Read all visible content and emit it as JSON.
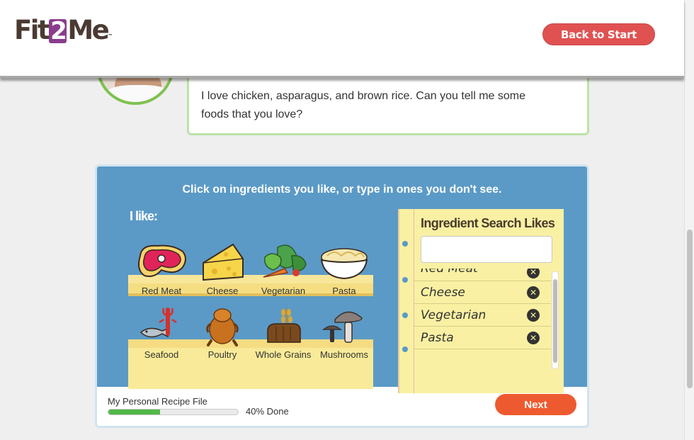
{
  "header": {
    "logo_pre": "Fit",
    "logo_num": "2",
    "logo_post": "Me",
    "logo_tm": "™",
    "back_label": "Back to Start"
  },
  "chat": {
    "line1": "I love chicken, asparagus, and brown rice. Can you tell me some",
    "line2": "foods that you love?"
  },
  "activity": {
    "instruction": "Click on ingredients you like, or type in ones you don't see.",
    "ilike": "I like:",
    "row1": [
      {
        "label": "Red Meat",
        "icon": "red-meat-icon"
      },
      {
        "label": "Cheese",
        "icon": "cheese-icon"
      },
      {
        "label": "Vegetarian",
        "icon": "vegetarian-icon"
      },
      {
        "label": "Pasta",
        "icon": "pasta-icon"
      }
    ],
    "row2": [
      {
        "label": "Seafood",
        "icon": "seafood-icon"
      },
      {
        "label": "Poultry",
        "icon": "poultry-icon"
      },
      {
        "label": "Whole Grains",
        "icon": "whole-grains-icon"
      },
      {
        "label": "Mushrooms",
        "icon": "mushrooms-icon"
      }
    ]
  },
  "notepad": {
    "title": "Ingredient Search Likes",
    "search_value": "",
    "items": [
      "Red Meat",
      "Cheese",
      "Vegetarian",
      "Pasta"
    ],
    "remove_glyph": "✕"
  },
  "footer": {
    "label": "My Personal Recipe File",
    "progress": 0.4,
    "pct_text": "40% Done",
    "next_label": "Next"
  },
  "colors": {
    "accent_red": "#e05252",
    "next_orange": "#ee5a2f",
    "panel_blue": "#5b9ac6",
    "progress_green": "#52b947",
    "avatar_ring": "#7ec24f"
  }
}
